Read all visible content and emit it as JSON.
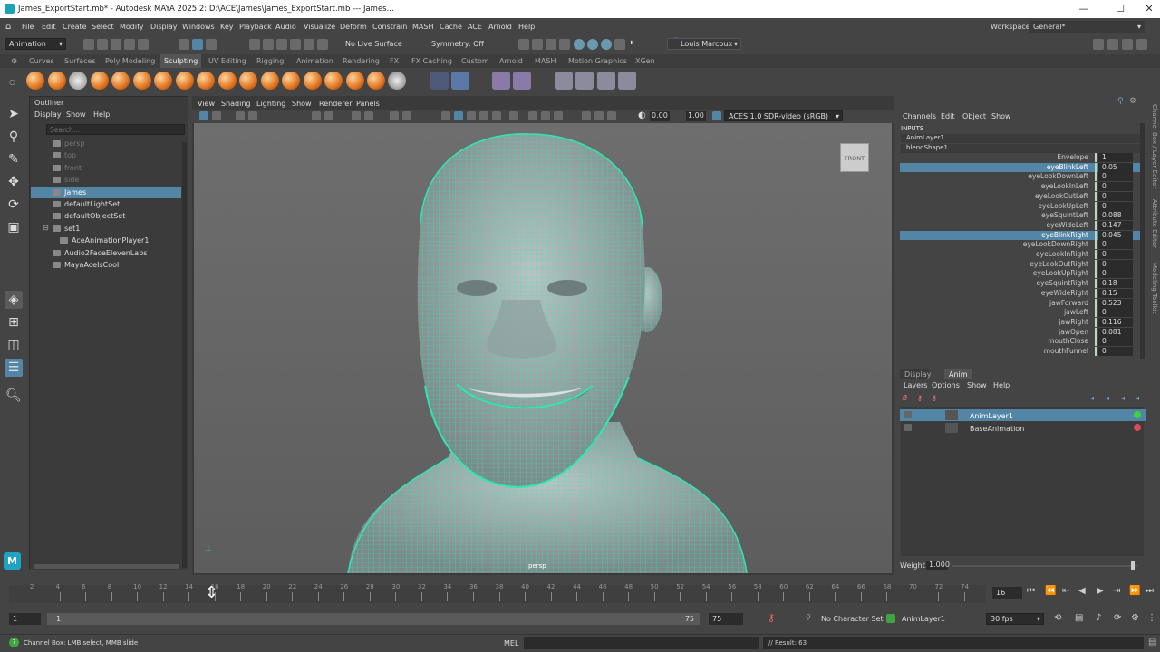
{
  "window": {
    "title": "James_ExportStart.mb* - Autodesk MAYA 2025.2: D:\\ACE\\James\\James_ExportStart.mb   ---   James...",
    "minimize": "—",
    "maximize": "☐",
    "close": "✕"
  },
  "menubar": {
    "items": [
      "File",
      "Edit",
      "Create",
      "Select",
      "Modify",
      "Display",
      "Windows",
      "Key",
      "Playback",
      "Audio",
      "Visualize",
      "Deform",
      "Constrain",
      "MASH",
      "Cache",
      "ACE",
      "Arnold",
      "Help"
    ],
    "workspace_label": "Workspace:",
    "workspace_value": "General*"
  },
  "statusline": {
    "menuset": "Animation",
    "live_surface": "No Live Surface",
    "symmetry": "Symmetry: Off",
    "user": "Louis Marcoux"
  },
  "shelf": {
    "tabs": [
      "Curves",
      "Surfaces",
      "Poly Modeling",
      "Sculpting",
      "UV Editing",
      "Rigging",
      "Animation",
      "Rendering",
      "FX",
      "FX Caching",
      "Custom",
      "Arnold",
      "MASH",
      "Motion Graphics",
      "XGen"
    ],
    "active_tab": "Sculpting"
  },
  "outliner": {
    "title": "Outliner",
    "menu": [
      "Display",
      "Show",
      "Help"
    ],
    "search_placeholder": "Search...",
    "items": [
      {
        "label": "persp",
        "dim": true,
        "indent": 0
      },
      {
        "label": "top",
        "dim": true,
        "indent": 0
      },
      {
        "label": "front",
        "dim": true,
        "indent": 0
      },
      {
        "label": "side",
        "dim": true,
        "indent": 0
      },
      {
        "label": "James",
        "selected": true,
        "indent": 0
      },
      {
        "label": "defaultLightSet",
        "indent": 0
      },
      {
        "label": "defaultObjectSet",
        "indent": 0
      },
      {
        "label": "set1",
        "indent": 0,
        "expand": "⊟"
      },
      {
        "label": "AceAnimationPlayer1",
        "indent": 1
      },
      {
        "label": "Audio2FaceElevenLabs",
        "indent": 0
      },
      {
        "label": "MayaAceIsCool",
        "indent": 0
      }
    ]
  },
  "viewport": {
    "menu": [
      "View",
      "Shading",
      "Lighting",
      "Show",
      "Renderer",
      "Panels"
    ],
    "exposure": "0.00",
    "gamma": "1.00",
    "color_space": "ACES 1.0 SDR-video (sRGB)",
    "camera_label": "persp",
    "cube_label": "FRONT"
  },
  "channel_box": {
    "menu": [
      "Channels",
      "Edit",
      "Object",
      "Show"
    ],
    "section": "INPUTS",
    "nodes": [
      "AnimLayer1",
      "blendShape1"
    ],
    "attributes": [
      {
        "name": "Envelope",
        "value": "1"
      },
      {
        "name": "eyeBlinkLeft",
        "value": "0.05",
        "selected": true
      },
      {
        "name": "eyeLookDownLeft",
        "value": "0"
      },
      {
        "name": "eyeLookInLeft",
        "value": "0"
      },
      {
        "name": "eyeLookOutLeft",
        "value": "0"
      },
      {
        "name": "eyeLookUpLeft",
        "value": "0"
      },
      {
        "name": "eyeSquintLeft",
        "value": "0.088"
      },
      {
        "name": "eyeWideLeft",
        "value": "0.147"
      },
      {
        "name": "eyeBlinkRight",
        "value": "0.045",
        "selected": true
      },
      {
        "name": "eyeLookDownRight",
        "value": "0"
      },
      {
        "name": "eyeLookInRight",
        "value": "0"
      },
      {
        "name": "eyeLookOutRight",
        "value": "0"
      },
      {
        "name": "eyeLookUpRight",
        "value": "0"
      },
      {
        "name": "eyeSquintRight",
        "value": "0.18"
      },
      {
        "name": "eyeWideRight",
        "value": "0.15"
      },
      {
        "name": "jawForward",
        "value": "0.523"
      },
      {
        "name": "jawLeft",
        "value": "0"
      },
      {
        "name": "jawRight",
        "value": "0.116"
      },
      {
        "name": "jawOpen",
        "value": "0.081"
      },
      {
        "name": "mouthClose",
        "value": "0"
      },
      {
        "name": "mouthFunnel",
        "value": "0"
      }
    ],
    "side_tabs": [
      "Channel Box / Layer Editor",
      "Attribute Editor",
      "Modeling Toolkit"
    ]
  },
  "layer_editor": {
    "tabs": [
      "Display",
      "Anim"
    ],
    "active_tab": "Anim",
    "menu": [
      "Layers",
      "Options",
      "Show",
      "Help"
    ],
    "layers": [
      {
        "name": "AnimLayer1",
        "selected": true,
        "dot": "#3fd13f"
      },
      {
        "name": "BaseAnimation",
        "selected": false,
        "dot": "#d84a5a"
      }
    ],
    "weight_label": "Weight",
    "weight_value": "1.000"
  },
  "timeline": {
    "ticks": [
      "2",
      "4",
      "6",
      "8",
      "10",
      "12",
      "14",
      "16",
      "18",
      "20",
      "22",
      "24",
      "26",
      "28",
      "30",
      "32",
      "34",
      "36",
      "38",
      "40",
      "42",
      "44",
      "46",
      "48",
      "50",
      "52",
      "54",
      "56",
      "58",
      "60",
      "62",
      "64",
      "66",
      "68",
      "70",
      "72",
      "74"
    ],
    "current_frame": "16"
  },
  "range": {
    "start": "1",
    "inner_start": "1",
    "inner_end": "75",
    "end": "75",
    "character_set": "No Character Set",
    "anim_layer": "AnimLayer1",
    "fps": "30 fps"
  },
  "helpline": {
    "text": "Channel Box: LMB select, MMB slide",
    "mel_label": "MEL",
    "result": "// Result: 63"
  },
  "colors": {
    "selection": "#5285a6",
    "wireframe": "#2ee8b4"
  }
}
